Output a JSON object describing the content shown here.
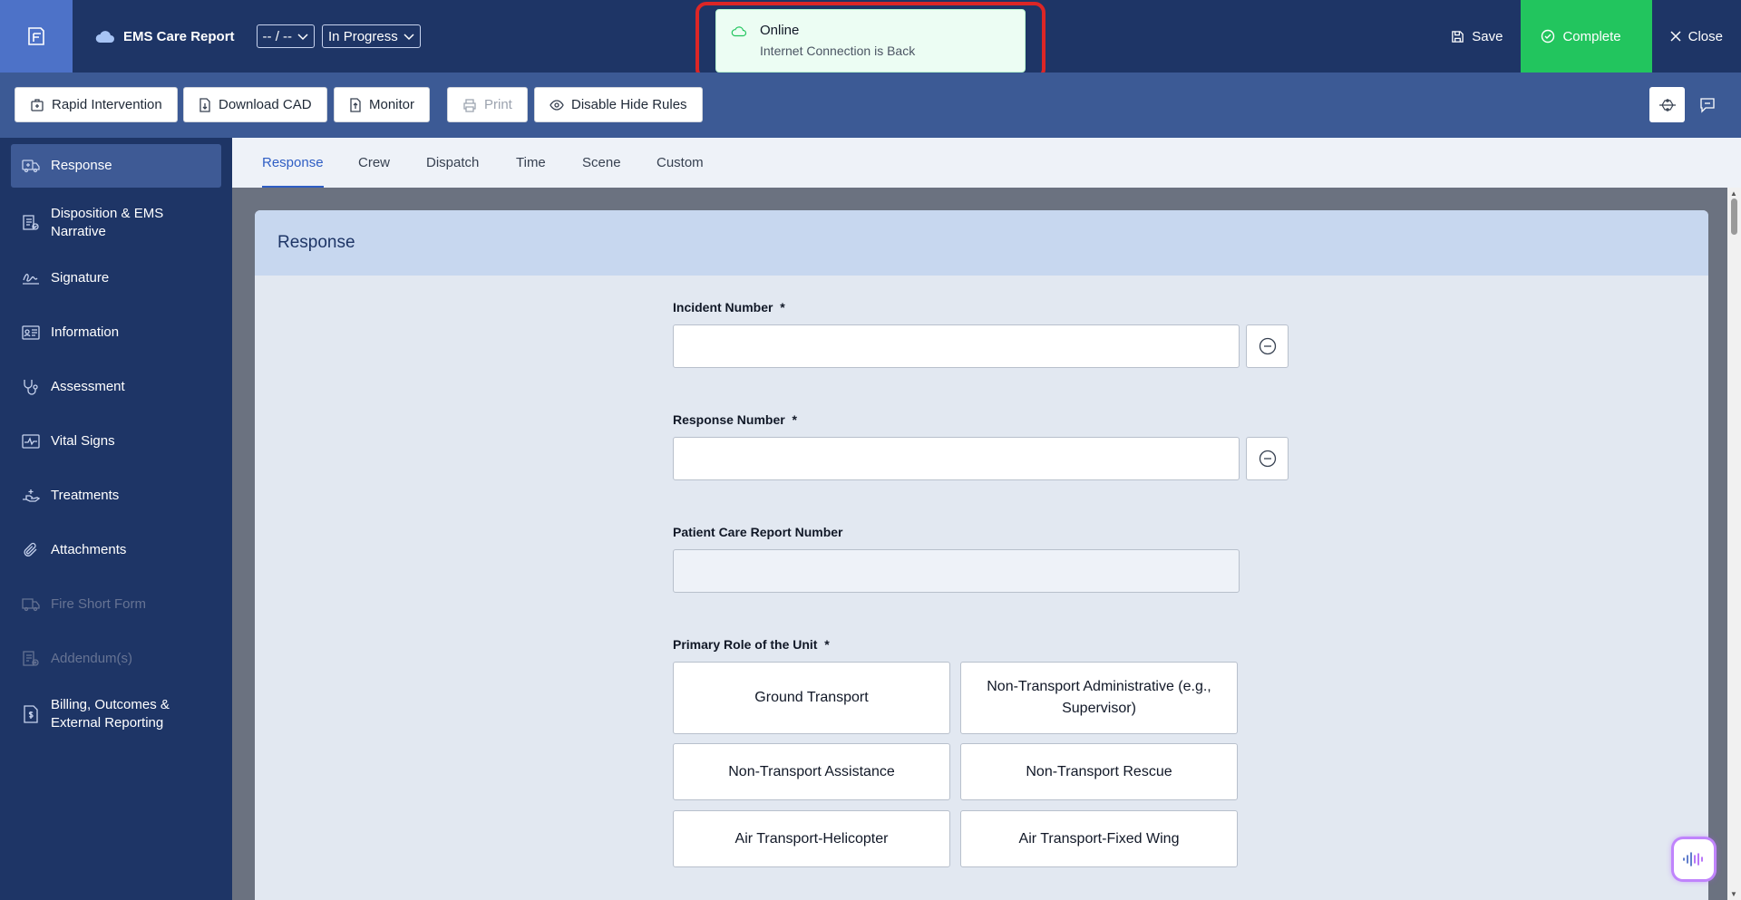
{
  "header": {
    "app_title": "EMS Care Report",
    "date_select": "-- / --",
    "status_select": "In Progress",
    "save_label": "Save",
    "complete_label": "Complete",
    "close_label": "Close"
  },
  "toast": {
    "title": "Online",
    "message": "Internet Connection is Back"
  },
  "toolbar": {
    "rapid_intervention": "Rapid Intervention",
    "download_cad": "Download CAD",
    "monitor": "Monitor",
    "print": "Print",
    "disable_hide_rules": "Disable Hide Rules"
  },
  "sidebar": {
    "items": [
      {
        "label": "Response",
        "icon": "ambulance-icon"
      },
      {
        "label": "Disposition & EMS Narrative",
        "icon": "clipboard-check-icon"
      },
      {
        "label": "Signature",
        "icon": "signature-icon"
      },
      {
        "label": "Information",
        "icon": "id-card-icon"
      },
      {
        "label": "Assessment",
        "icon": "stethoscope-icon"
      },
      {
        "label": "Vital Signs",
        "icon": "heartbeat-icon"
      },
      {
        "label": "Treatments",
        "icon": "hand-treatment-icon"
      },
      {
        "label": "Attachments",
        "icon": "paperclip-icon"
      },
      {
        "label": "Fire Short Form",
        "icon": "truck-icon"
      },
      {
        "label": "Addendum(s)",
        "icon": "document-add-icon"
      },
      {
        "label": "Billing, Outcomes & External Reporting",
        "icon": "billing-icon"
      }
    ]
  },
  "tabs": [
    "Response",
    "Crew",
    "Dispatch",
    "Time",
    "Scene",
    "Custom"
  ],
  "form": {
    "section_title": "Response",
    "incident_number_label": "Incident Number",
    "response_number_label": "Response Number",
    "pcr_number_label": "Patient Care Report Number",
    "primary_role_label": "Primary Role of the Unit",
    "required_mark": "*",
    "incident_number_value": "",
    "response_number_value": "",
    "pcr_number_value": "",
    "role_options": [
      "Ground Transport",
      "Non-Transport Administrative (e.g., Supervisor)",
      "Non-Transport Assistance",
      "Non-Transport Rescue",
      "Air Transport-Helicopter",
      "Air Transport-Fixed Wing"
    ]
  },
  "colors": {
    "nav_bg": "#1e3566",
    "toolbar_bg": "#3c5a95",
    "complete_green": "#22c55e",
    "accent_blue": "#2f5ec4",
    "highlight_red": "#dc2626"
  }
}
